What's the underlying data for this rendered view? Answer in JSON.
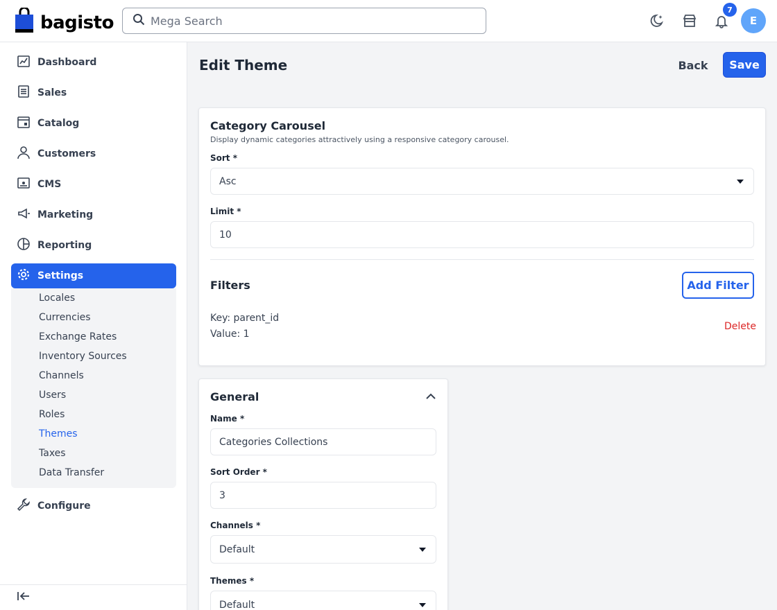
{
  "header": {
    "brand": "bagisto",
    "search_placeholder": "Mega Search",
    "notification_count": "7",
    "avatar_initial": "E"
  },
  "sidebar": {
    "items": [
      {
        "label": "Dashboard",
        "icon": "dashboard-icon"
      },
      {
        "label": "Sales",
        "icon": "sales-icon"
      },
      {
        "label": "Catalog",
        "icon": "catalog-icon"
      },
      {
        "label": "Customers",
        "icon": "customers-icon"
      },
      {
        "label": "CMS",
        "icon": "cms-icon"
      },
      {
        "label": "Marketing",
        "icon": "marketing-icon"
      },
      {
        "label": "Reporting",
        "icon": "reporting-icon"
      },
      {
        "label": "Settings",
        "icon": "settings-icon",
        "active": true
      },
      {
        "label": "Configure",
        "icon": "configure-icon"
      }
    ],
    "settings_submenu": [
      "Locales",
      "Currencies",
      "Exchange Rates",
      "Inventory Sources",
      "Channels",
      "Users",
      "Roles",
      "Themes",
      "Taxes",
      "Data Transfer"
    ],
    "active_submenu": "Themes"
  },
  "page": {
    "title": "Edit Theme",
    "back_label": "Back",
    "save_label": "Save"
  },
  "carousel_card": {
    "title": "Category Carousel",
    "description": "Display dynamic categories attractively using a responsive category carousel.",
    "sort_label": "Sort *",
    "sort_value": "Asc",
    "limit_label": "Limit *",
    "limit_value": "10",
    "filters_title": "Filters",
    "add_filter_label": "Add Filter",
    "filter_key": "Key: parent_id",
    "filter_value": "Value: 1",
    "delete_label": "Delete"
  },
  "general_card": {
    "title": "General",
    "name_label": "Name *",
    "name_value": "Categories Collections",
    "sort_order_label": "Sort Order *",
    "sort_order_value": "3",
    "channels_label": "Channels *",
    "channels_value": "Default",
    "themes_label": "Themes *",
    "themes_value": "Default"
  },
  "colors": {
    "primary": "#2563eb",
    "danger": "#dc2626"
  }
}
